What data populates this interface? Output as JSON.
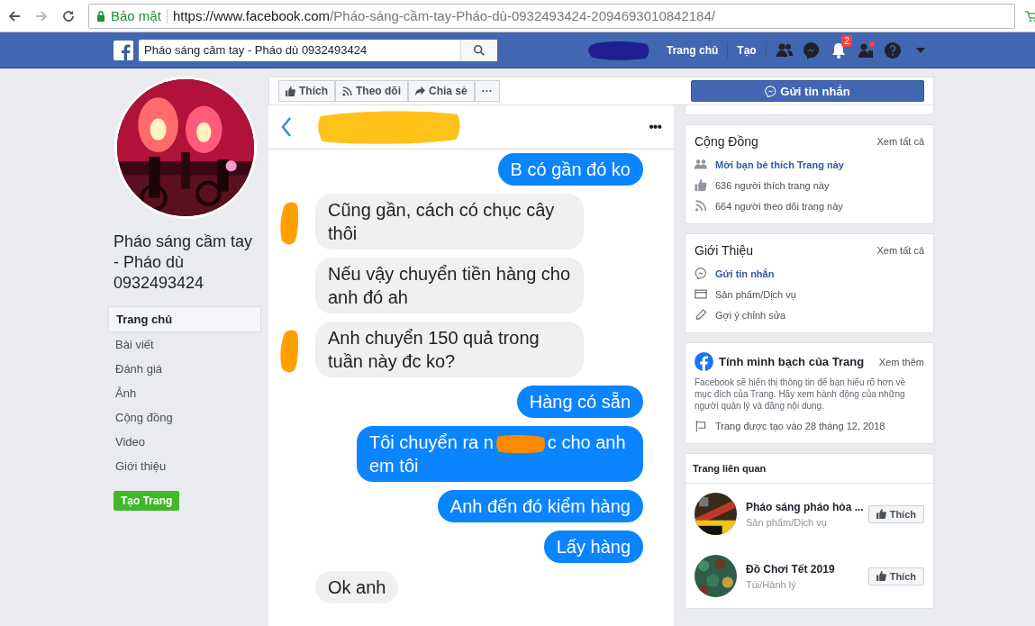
{
  "browser": {
    "security": "Bảo mật",
    "url_host": "https://www.facebook.com",
    "url_path": "/Pháo-sáng-cầm-tay-Pháo-dù-0932493424-2094693010842184/"
  },
  "topbar": {
    "search_value": "Pháo sáng câm tay - Pháo dù 0932493424",
    "links": [
      "Trang chủ",
      "Tạo"
    ],
    "notification_count": "2"
  },
  "page": {
    "title": "Pháo sáng cầm tay - Pháo dù 0932493424",
    "nav": [
      {
        "label": "Trang chủ",
        "selected": true
      },
      {
        "label": "Bài viết",
        "selected": false
      },
      {
        "label": "Đánh giá",
        "selected": false
      },
      {
        "label": "Ảnh",
        "selected": false
      },
      {
        "label": "Cộng đồng",
        "selected": false
      },
      {
        "label": "Video",
        "selected": false
      },
      {
        "label": "Giới thiệu",
        "selected": false
      }
    ],
    "create_button": "Tạo Trang"
  },
  "actions": [
    {
      "kind": "like",
      "label": "Thích"
    },
    {
      "kind": "follow",
      "label": "Theo dõi"
    },
    {
      "kind": "share",
      "label": "Chia sẻ"
    },
    {
      "kind": "more",
      "label": "···"
    }
  ],
  "message_button": "Gửi tin nhắn",
  "chat": {
    "menu": "•••",
    "messages": [
      {
        "kind": "sent",
        "parts": [
          "B có gần đó ko"
        ]
      },
      {
        "kind": "received",
        "avatar": true,
        "parts": [
          "Cũng gần, cách có chục cây thôi"
        ]
      },
      {
        "kind": "received",
        "avatar": false,
        "parts": [
          "Nếu vậy chuyển tiền hàng cho anh đó ah"
        ]
      },
      {
        "kind": "received",
        "avatar": true,
        "parts": [
          "Anh chuyển 150 quả trong tuần này đc ko?"
        ]
      },
      {
        "kind": "sent",
        "parts": [
          "Hàng có sẵn"
        ]
      },
      {
        "kind": "sent",
        "parts": [
          "Tôi chuyển ra n",
          "c cho anh em tôi"
        ]
      },
      {
        "kind": "sent",
        "parts": [
          "Anh đến đó kiểm hàng"
        ]
      },
      {
        "kind": "sent",
        "parts": [
          "Lấy hàng"
        ]
      },
      {
        "kind": "received",
        "avatar": false,
        "parts": [
          "Ok anh"
        ]
      }
    ]
  },
  "community": {
    "title": "Cộng Đồng",
    "see_all": "Xem tất cả",
    "items": [
      {
        "kind": "invite",
        "text": "Mời bạn bè thích Trang này"
      },
      {
        "kind": "likes",
        "text": "636 người thích trang này"
      },
      {
        "kind": "follows",
        "text": "664 người theo dõi trang này"
      }
    ]
  },
  "about": {
    "title": "Giới Thiệu",
    "see_all": "Xem tất cả",
    "items": [
      {
        "kind": "message",
        "text": "Gửi tin nhắn"
      },
      {
        "kind": "category",
        "text": "Sản phẩm/Dịch vụ"
      },
      {
        "kind": "edit",
        "text": "Gợi ý chỉnh sửa"
      }
    ]
  },
  "transparency": {
    "title": "Tính minh bạch của Trang",
    "see_more": "Xem thêm",
    "description": "Facebook sẽ hiển thị thông tin để bạn hiểu rõ hơn về mục đích của Trang. Hãy xem hành động của những người quản lý và đăng nội dung.",
    "created": "Trang được tạo vào 28 tháng 12, 2018"
  },
  "related": {
    "title": "Trang liên quan",
    "items": [
      {
        "name": "Pháo sáng pháo hỏa ...",
        "category": "Sản phẩm/Dịch vụ",
        "like": "Thích"
      },
      {
        "name": "Đồ Chơi Tết 2019",
        "category": "Túi/Hành lý",
        "like": "Thích"
      }
    ]
  }
}
